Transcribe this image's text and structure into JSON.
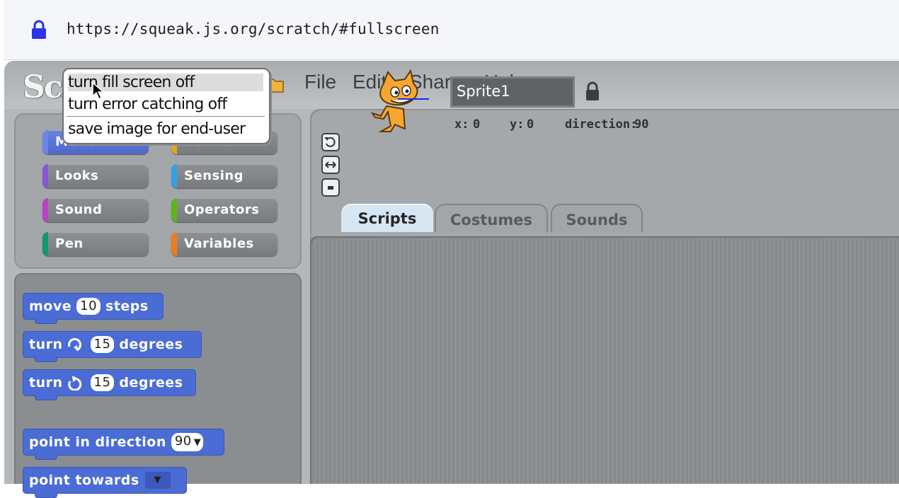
{
  "browser": {
    "url": "https://squeak.js.org/scratch/#fullscreen",
    "lock_icon": "lock-icon"
  },
  "topbar": {
    "logo_text": "Scratch",
    "folder_icon": "folder-icon",
    "menus": [
      "File",
      "Edit",
      "Share",
      "Help"
    ]
  },
  "categories": [
    {
      "label": "Motion",
      "color": "#4a6cd4"
    },
    {
      "label": "Control",
      "color": "#e1a91a"
    },
    {
      "label": "Looks",
      "color": "#8a55d7"
    },
    {
      "label": "Sensing",
      "color": "#2ca5e2"
    },
    {
      "label": "Sound",
      "color": "#bb42c3"
    },
    {
      "label": "Operators",
      "color": "#5cb712"
    },
    {
      "label": "Pen",
      "color": "#0e9a6c"
    },
    {
      "label": "Variables",
      "color": "#ee7d16"
    }
  ],
  "blocks": {
    "move": {
      "pre": "move",
      "value": "10",
      "post": "steps"
    },
    "turn_cw": {
      "pre": "turn",
      "value": "15",
      "post": "degrees",
      "icon": "rotate-clockwise-icon"
    },
    "turn_ccw": {
      "pre": "turn",
      "value": "15",
      "post": "degrees",
      "icon": "rotate-counterclockwise-icon"
    },
    "point_dir": {
      "pre": "point in direction",
      "value": "90"
    },
    "point_towards": {
      "pre": "point towards"
    }
  },
  "sprite": {
    "name": "Sprite1",
    "x_label": "x:",
    "x": "0",
    "y_label": "y:",
    "y": "0",
    "dir_label": "direction:",
    "direction": "90"
  },
  "tabs": [
    "Scripts",
    "Costumes",
    "Sounds"
  ],
  "popup": {
    "items": [
      "turn fill screen off",
      "turn error catching off",
      "save image for end-user"
    ]
  }
}
